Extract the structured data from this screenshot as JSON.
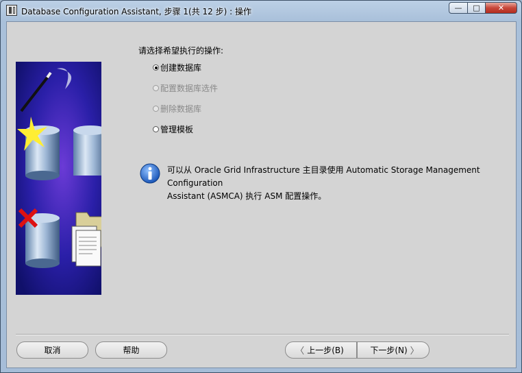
{
  "window": {
    "title": "Database Configuration Assistant, 步骤 1(共 12 步) : 操作",
    "minimize_glyph": "—",
    "maximize_glyph": "□",
    "close_glyph": "✕"
  },
  "content": {
    "prompt": "请选择希望执行的操作:",
    "options": [
      {
        "label": "创建数据库",
        "checked": true,
        "disabled": false
      },
      {
        "label": "配置数据库选件",
        "checked": false,
        "disabled": true
      },
      {
        "label": "删除数据库",
        "checked": false,
        "disabled": true
      },
      {
        "label": "管理模板",
        "checked": false,
        "disabled": false
      }
    ],
    "info_icon": "info-icon",
    "info_text_line1": "可以从 Oracle Grid Infrastructure 主目录使用 Automatic Storage Management Configuration",
    "info_text_line2": "Assistant (ASMCA) 执行 ASM 配置操作。"
  },
  "buttons": {
    "cancel": "取消",
    "help": "帮助",
    "back": "上一步(B)",
    "next": "下一步(N)",
    "back_icon": "chevron-left-icon",
    "next_icon": "chevron-right-icon"
  },
  "colors": {
    "art_background": "#2a1fa8",
    "checkmark": "#cc0000"
  }
}
